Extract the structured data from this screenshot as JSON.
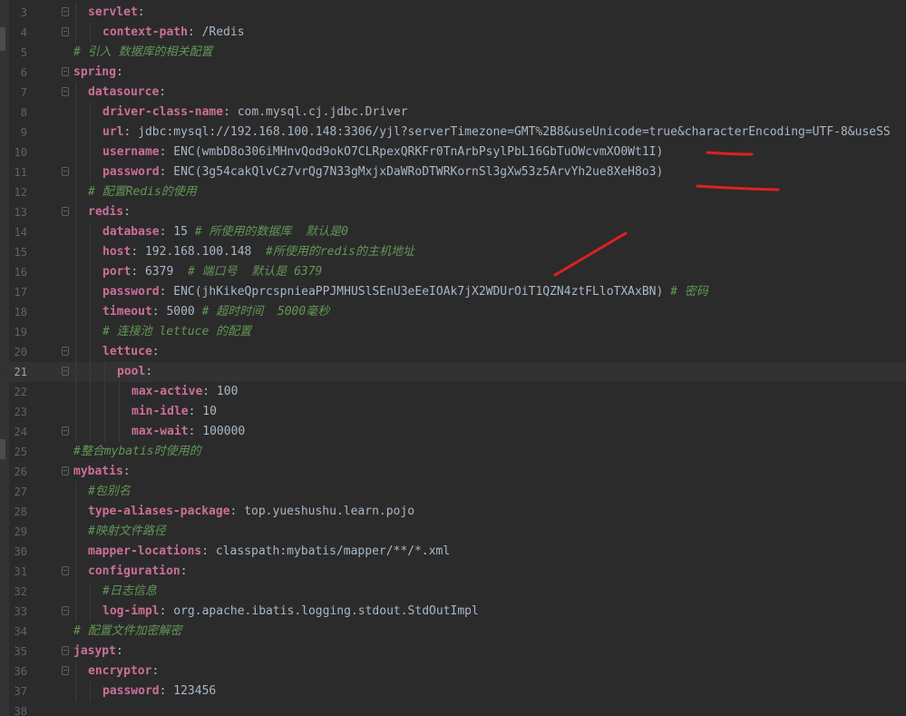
{
  "editor": {
    "current_line": 21,
    "lines": [
      {
        "n": "3",
        "indent": 1,
        "fold": true,
        "parts": [
          {
            "t": "servlet",
            "c": "key"
          },
          {
            "t": ":",
            "c": "v"
          }
        ]
      },
      {
        "n": "4",
        "indent": 2,
        "fold": true,
        "parts": [
          {
            "t": "context-path",
            "c": "key"
          },
          {
            "t": ": /Redis",
            "c": "v"
          }
        ]
      },
      {
        "n": "5",
        "indent": 0,
        "fold": false,
        "parts": [
          {
            "t": "# 引入 数据库的相关配置",
            "c": "c"
          }
        ]
      },
      {
        "n": "6",
        "indent": 0,
        "fold": true,
        "parts": [
          {
            "t": "spring",
            "c": "key"
          },
          {
            "t": ":",
            "c": "v"
          }
        ]
      },
      {
        "n": "7",
        "indent": 1,
        "fold": true,
        "parts": [
          {
            "t": "datasource",
            "c": "key"
          },
          {
            "t": ":",
            "c": "v"
          }
        ]
      },
      {
        "n": "8",
        "indent": 2,
        "fold": false,
        "parts": [
          {
            "t": "driver-class-name",
            "c": "key"
          },
          {
            "t": ": com.mysql.cj.jdbc.Driver",
            "c": "v"
          }
        ]
      },
      {
        "n": "9",
        "indent": 2,
        "fold": false,
        "parts": [
          {
            "t": "url",
            "c": "key"
          },
          {
            "t": ": jdbc:mysql://192.168.100.148:3306/yjl?serverTimezone=GMT%2B8&useUnicode=true&characterEncoding=UTF-8&useSS",
            "c": "v"
          }
        ]
      },
      {
        "n": "10",
        "indent": 2,
        "fold": false,
        "parts": [
          {
            "t": "username",
            "c": "key"
          },
          {
            "t": ": ENC(wmbD8o306iMHnvQod9okO7CLRpexQRKFr0TnArbPsylPbL16GbTuOWcvmXO0Wt1I)",
            "c": "v"
          }
        ]
      },
      {
        "n": "11",
        "indent": 2,
        "fold": true,
        "parts": [
          {
            "t": "password",
            "c": "key"
          },
          {
            "t": ": ENC(3g54cakQlvCz7vrQg7N33gMxjxDaWRoDTWRKornSl3gXw53z5ArvYh2ue8XeH8o3)",
            "c": "v"
          }
        ]
      },
      {
        "n": "12",
        "indent": 1,
        "fold": false,
        "parts": [
          {
            "t": "# 配置Redis的使用",
            "c": "c"
          }
        ]
      },
      {
        "n": "13",
        "indent": 1,
        "fold": true,
        "parts": [
          {
            "t": "redis",
            "c": "key"
          },
          {
            "t": ":",
            "c": "v"
          }
        ]
      },
      {
        "n": "14",
        "indent": 2,
        "fold": false,
        "parts": [
          {
            "t": "database",
            "c": "key"
          },
          {
            "t": ": 15 ",
            "c": "v"
          },
          {
            "t": "# 所使用的数据库  默认是0",
            "c": "c"
          }
        ]
      },
      {
        "n": "15",
        "indent": 2,
        "fold": false,
        "parts": [
          {
            "t": "host",
            "c": "key"
          },
          {
            "t": ": 192.168.100.148  ",
            "c": "v"
          },
          {
            "t": "#所使用的redis的主机地址",
            "c": "c"
          }
        ]
      },
      {
        "n": "16",
        "indent": 2,
        "fold": false,
        "parts": [
          {
            "t": "port",
            "c": "key"
          },
          {
            "t": ": 6379  ",
            "c": "v"
          },
          {
            "t": "# 端口号  默认是 6379",
            "c": "c"
          }
        ]
      },
      {
        "n": "17",
        "indent": 2,
        "fold": false,
        "parts": [
          {
            "t": "password",
            "c": "key"
          },
          {
            "t": ": ENC(jhKikeQprcspnieaPPJMHUSlSEnU3eEeIOAk7jX2WDUrOiT1QZN4ztFLloTXAxBN) ",
            "c": "v"
          },
          {
            "t": "# 密码",
            "c": "c"
          }
        ]
      },
      {
        "n": "18",
        "indent": 2,
        "fold": false,
        "parts": [
          {
            "t": "timeout",
            "c": "key"
          },
          {
            "t": ": 5000 ",
            "c": "v"
          },
          {
            "t": "# 超时时间  5000毫秒",
            "c": "c"
          }
        ]
      },
      {
        "n": "19",
        "indent": 2,
        "fold": false,
        "parts": [
          {
            "t": "# 连接池 lettuce 的配置",
            "c": "c"
          }
        ]
      },
      {
        "n": "20",
        "indent": 2,
        "fold": true,
        "parts": [
          {
            "t": "lettuce",
            "c": "key"
          },
          {
            "t": ":",
            "c": "v"
          }
        ]
      },
      {
        "n": "21",
        "indent": 3,
        "fold": true,
        "parts": [
          {
            "t": "pool",
            "c": "key"
          },
          {
            "t": ":",
            "c": "v"
          }
        ]
      },
      {
        "n": "22",
        "indent": 4,
        "fold": false,
        "parts": [
          {
            "t": "max-active",
            "c": "key"
          },
          {
            "t": ": 100",
            "c": "v"
          }
        ]
      },
      {
        "n": "23",
        "indent": 4,
        "fold": false,
        "parts": [
          {
            "t": "min-idle",
            "c": "key"
          },
          {
            "t": ": 10",
            "c": "v"
          }
        ]
      },
      {
        "n": "24",
        "indent": 4,
        "fold": true,
        "parts": [
          {
            "t": "max-wait",
            "c": "key"
          },
          {
            "t": ": 100000",
            "c": "v"
          }
        ]
      },
      {
        "n": "25",
        "indent": 0,
        "fold": false,
        "parts": [
          {
            "t": "#整合mybatis时使用的",
            "c": "c"
          }
        ]
      },
      {
        "n": "26",
        "indent": 0,
        "fold": true,
        "parts": [
          {
            "t": "mybatis",
            "c": "key"
          },
          {
            "t": ":",
            "c": "v"
          }
        ]
      },
      {
        "n": "27",
        "indent": 1,
        "fold": false,
        "parts": [
          {
            "t": "#包别名",
            "c": "c"
          }
        ]
      },
      {
        "n": "28",
        "indent": 1,
        "fold": false,
        "parts": [
          {
            "t": "type-aliases-package",
            "c": "key"
          },
          {
            "t": ": top.yueshushu.learn.pojo",
            "c": "v"
          }
        ]
      },
      {
        "n": "29",
        "indent": 1,
        "fold": false,
        "parts": [
          {
            "t": "#映射文件路径",
            "c": "c"
          }
        ]
      },
      {
        "n": "30",
        "indent": 1,
        "fold": false,
        "parts": [
          {
            "t": "mapper-locations",
            "c": "key"
          },
          {
            "t": ": classpath:mybatis/mapper/**/*.xml",
            "c": "v"
          }
        ]
      },
      {
        "n": "31",
        "indent": 1,
        "fold": true,
        "parts": [
          {
            "t": "configuration",
            "c": "key"
          },
          {
            "t": ":",
            "c": "v"
          }
        ]
      },
      {
        "n": "32",
        "indent": 2,
        "fold": false,
        "parts": [
          {
            "t": "#日志信息",
            "c": "c"
          }
        ]
      },
      {
        "n": "33",
        "indent": 2,
        "fold": true,
        "parts": [
          {
            "t": "log-impl",
            "c": "key"
          },
          {
            "t": ": org.apache.ibatis.logging.stdout.StdOutImpl",
            "c": "v"
          }
        ]
      },
      {
        "n": "34",
        "indent": 0,
        "fold": false,
        "parts": [
          {
            "t": "# 配置文件加密解密",
            "c": "c"
          }
        ]
      },
      {
        "n": "35",
        "indent": 0,
        "fold": true,
        "parts": [
          {
            "t": "jasypt",
            "c": "key"
          },
          {
            "t": ":",
            "c": "v"
          }
        ]
      },
      {
        "n": "36",
        "indent": 1,
        "fold": true,
        "parts": [
          {
            "t": "encryptor",
            "c": "key"
          },
          {
            "t": ":",
            "c": "v"
          }
        ]
      },
      {
        "n": "37",
        "indent": 2,
        "fold": false,
        "parts": [
          {
            "t": "password",
            "c": "key"
          },
          {
            "t": ": 123456",
            "c": "v"
          }
        ]
      },
      {
        "n": "38",
        "indent": 0,
        "fold": false,
        "parts": []
      }
    ]
  },
  "colors": {
    "background": "#2b2b2b",
    "key": "#cc6f99",
    "value": "#a9b7c6",
    "comment": "#629755",
    "line_number": "#606366",
    "annotation": "#e0201f"
  }
}
